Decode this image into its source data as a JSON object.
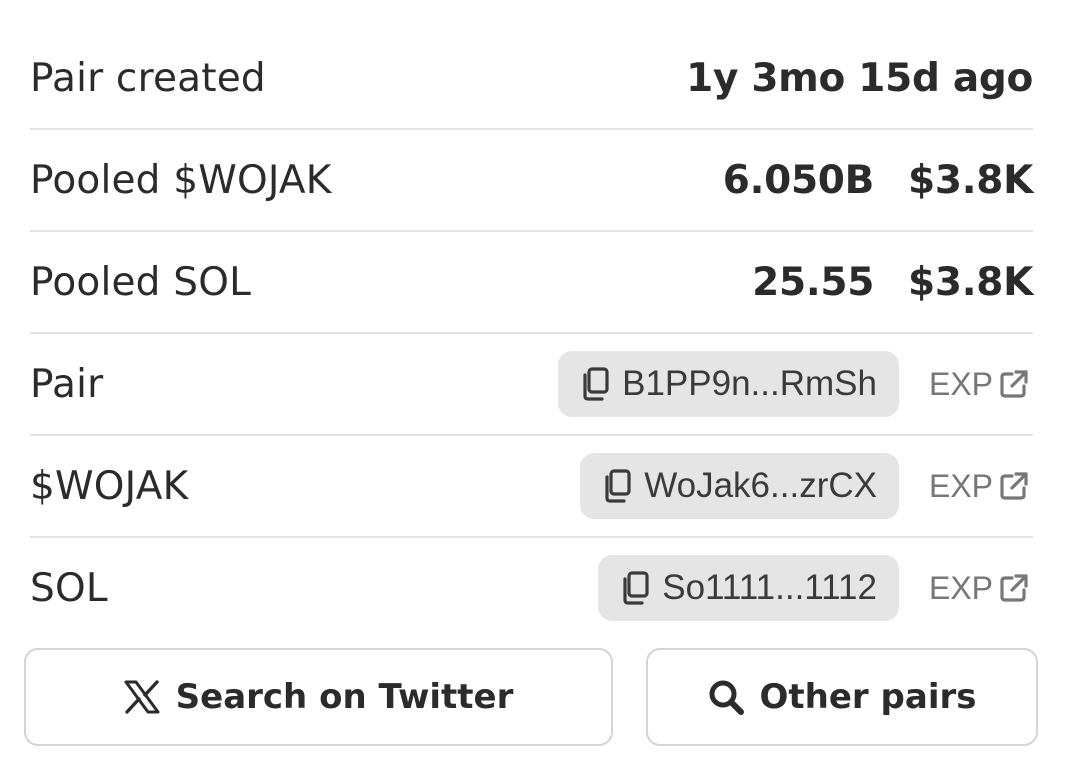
{
  "info_rows": [
    {
      "label": "Pair created",
      "value": "1y 3mo 15d ago"
    },
    {
      "label": "Pooled $WOJAK",
      "amount": "6.050B",
      "usd": "$3.8K"
    },
    {
      "label": "Pooled SOL",
      "amount": "25.55",
      "usd": "$3.8K"
    }
  ],
  "address_rows": [
    {
      "label": "Pair",
      "address": "B1PP9n...RmSh",
      "link": "EXP"
    },
    {
      "label": "$WOJAK",
      "address": "WoJak6...zrCX",
      "link": "EXP"
    },
    {
      "label": "SOL",
      "address": "So1111...1112",
      "link": "EXP"
    }
  ],
  "buttons": {
    "twitter_label": "Search on Twitter",
    "other_pairs_label": "Other pairs"
  },
  "icons": {
    "copy": "copy-icon",
    "external": "external-link-icon",
    "x_logo": "x-logo-icon",
    "search": "search-icon"
  },
  "colors": {
    "text": "#2b2b2b",
    "muted": "#777777",
    "chip_bg": "#e5e5e5",
    "divider": "#e3e3e3",
    "button_border": "#d4d4d4"
  }
}
